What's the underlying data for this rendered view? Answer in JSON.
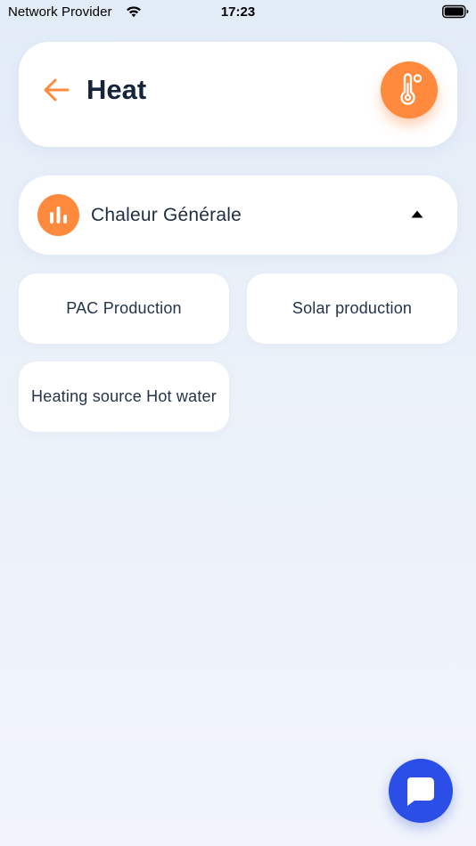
{
  "status_bar": {
    "carrier": "Network Provider",
    "time": "17:23",
    "wifi_icon": "wifi-icon",
    "battery_icon": "battery-icon"
  },
  "header": {
    "title": "Heat",
    "back_icon": "arrow-left-icon",
    "badge_icon": "thermometer-icon"
  },
  "category": {
    "label": "Chaleur Générale",
    "icon": "bar-chart-icon",
    "toggle_icon": "caret-up-icon"
  },
  "options": [
    {
      "label": "PAC Production"
    },
    {
      "label": "Solar production"
    },
    {
      "label": "Heating source Hot water"
    }
  ],
  "chat": {
    "icon": "chat-bubble-icon"
  },
  "colors": {
    "accent": "#ff8a3d",
    "chat_button": "#2b4ee6",
    "title_text": "#15243a",
    "card_background": "#ffffff",
    "page_background": "#e6eef8"
  }
}
